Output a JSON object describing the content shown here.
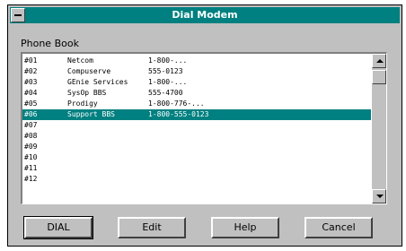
{
  "window": {
    "title": "Dial Modem"
  },
  "phonebook": {
    "label": "Phone Book",
    "entries": [
      {
        "num": "#01",
        "name": "Netcom",
        "phone": "1-800-..."
      },
      {
        "num": "#02",
        "name": "Compuserve",
        "phone": "555-0123"
      },
      {
        "num": "#03",
        "name": "GEnie Services",
        "phone": "1-800-..."
      },
      {
        "num": "#04",
        "name": "SysOp BBS",
        "phone": "555-4700"
      },
      {
        "num": "#05",
        "name": "Prodigy",
        "phone": "1-800-776-..."
      },
      {
        "num": "#06",
        "name": "Support BBS",
        "phone": "1-800-555-0123",
        "selected": true
      },
      {
        "num": "#07",
        "name": "",
        "phone": ""
      },
      {
        "num": "#08",
        "name": "",
        "phone": ""
      },
      {
        "num": "#09",
        "name": "",
        "phone": ""
      },
      {
        "num": "#10",
        "name": "",
        "phone": ""
      },
      {
        "num": "#11",
        "name": "",
        "phone": ""
      },
      {
        "num": "#12",
        "name": "",
        "phone": ""
      }
    ]
  },
  "buttons": {
    "dial": "DIAL",
    "edit": "Edit",
    "help": "Help",
    "cancel": "Cancel"
  }
}
